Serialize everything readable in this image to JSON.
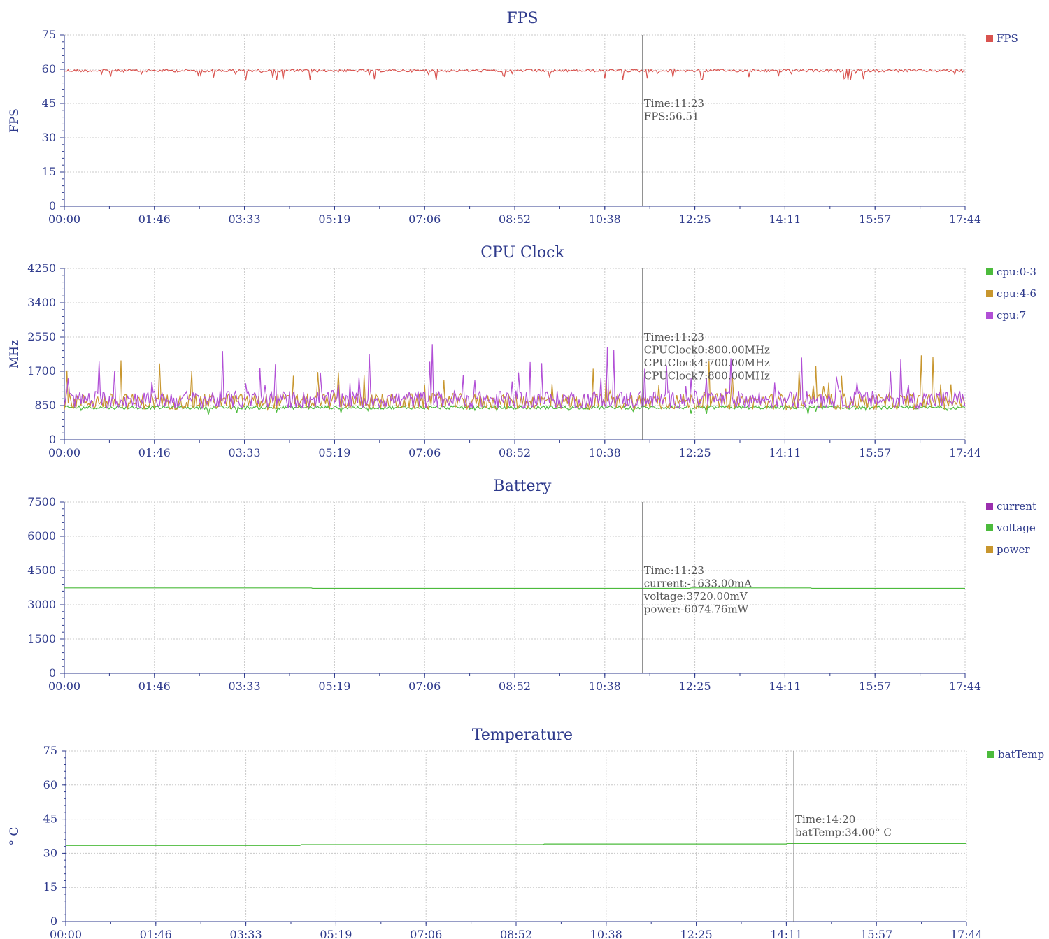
{
  "chart_data": [
    {
      "type": "line",
      "title": "FPS",
      "ylabel": "FPS",
      "xlabel": "",
      "ylim": [
        0,
        75
      ],
      "yticks": [
        "0",
        "15",
        "30",
        "45",
        "60",
        "75"
      ],
      "x_ticks": [
        "00:00",
        "01:46",
        "03:33",
        "05:19",
        "07:06",
        "08:52",
        "10:38",
        "12:25",
        "14:11",
        "15:57",
        "17:44"
      ],
      "grid": true,
      "legend_position": "right",
      "series": [
        {
          "name": "FPS",
          "color": "#d9534f",
          "base": 60,
          "noise": 1.2,
          "dips": 55
        }
      ],
      "cursor": {
        "time": "11:23",
        "lines": [
          "Time:11:23",
          "FPS:56.51"
        ]
      }
    },
    {
      "type": "line",
      "title": "CPU Clock",
      "ylabel": "MHz",
      "xlabel": "",
      "ylim": [
        0,
        4250
      ],
      "yticks": [
        "0",
        "850",
        "1700",
        "2550",
        "3400",
        "4250"
      ],
      "x_ticks": [
        "00:00",
        "01:46",
        "03:33",
        "05:19",
        "07:06",
        "08:52",
        "10:38",
        "12:25",
        "14:11",
        "15:57",
        "17:44"
      ],
      "grid": true,
      "legend_position": "right",
      "series": [
        {
          "name": "cpu:0-3",
          "color": "#4cbb3c",
          "base": 800,
          "noise": 40
        },
        {
          "name": "cpu:4-6",
          "color": "#c8962e",
          "base": 950,
          "noise": 200
        },
        {
          "name": "cpu:7",
          "color": "#b14fd6",
          "base": 1000,
          "noise": 220
        }
      ],
      "cursor": {
        "time": "11:23",
        "lines": [
          "Time:11:23",
          "CPUClock0:800.00MHz",
          "CPUClock4:700.00MHz",
          "CPUClock7:800.00MHz"
        ]
      }
    },
    {
      "type": "line",
      "title": "Battery",
      "ylabel": "",
      "xlabel": "",
      "ylim": [
        0,
        7500
      ],
      "yticks": [
        "0",
        "1500",
        "3000",
        "4500",
        "6000",
        "7500"
      ],
      "x_ticks": [
        "00:00",
        "01:46",
        "03:33",
        "05:19",
        "07:06",
        "08:52",
        "10:38",
        "12:25",
        "14:11",
        "15:57",
        "17:44"
      ],
      "grid": true,
      "legend_position": "right",
      "series": [
        {
          "name": "current",
          "color": "#9b2fae",
          "base": null,
          "noise": 0
        },
        {
          "name": "voltage",
          "color": "#4cbb3c",
          "base": 3720,
          "noise": 0
        },
        {
          "name": "power",
          "color": "#c8962e",
          "base": null,
          "noise": 0
        }
      ],
      "cursor": {
        "time": "11:23",
        "lines": [
          "Time:11:23",
          "current:-1633.00mA",
          "voltage:3720.00mV",
          "power:-6074.76mW"
        ]
      }
    },
    {
      "type": "line",
      "title": "Temperature",
      "ylabel": "° C",
      "xlabel": "",
      "ylim": [
        0,
        75
      ],
      "yticks": [
        "0",
        "15",
        "30",
        "45",
        "60",
        "75"
      ],
      "x_ticks": [
        "00:00",
        "01:46",
        "03:33",
        "05:19",
        "07:06",
        "08:52",
        "10:38",
        "12:25",
        "14:11",
        "15:57",
        "17:44"
      ],
      "grid": true,
      "legend_position": "right",
      "series": [
        {
          "name": "batTemp",
          "color": "#4cbb3c",
          "base": 34,
          "noise": 0
        }
      ],
      "cursor": {
        "time": "14:20",
        "lines": [
          "Time:14:20",
          "batTemp:34.00° C"
        ]
      }
    }
  ]
}
